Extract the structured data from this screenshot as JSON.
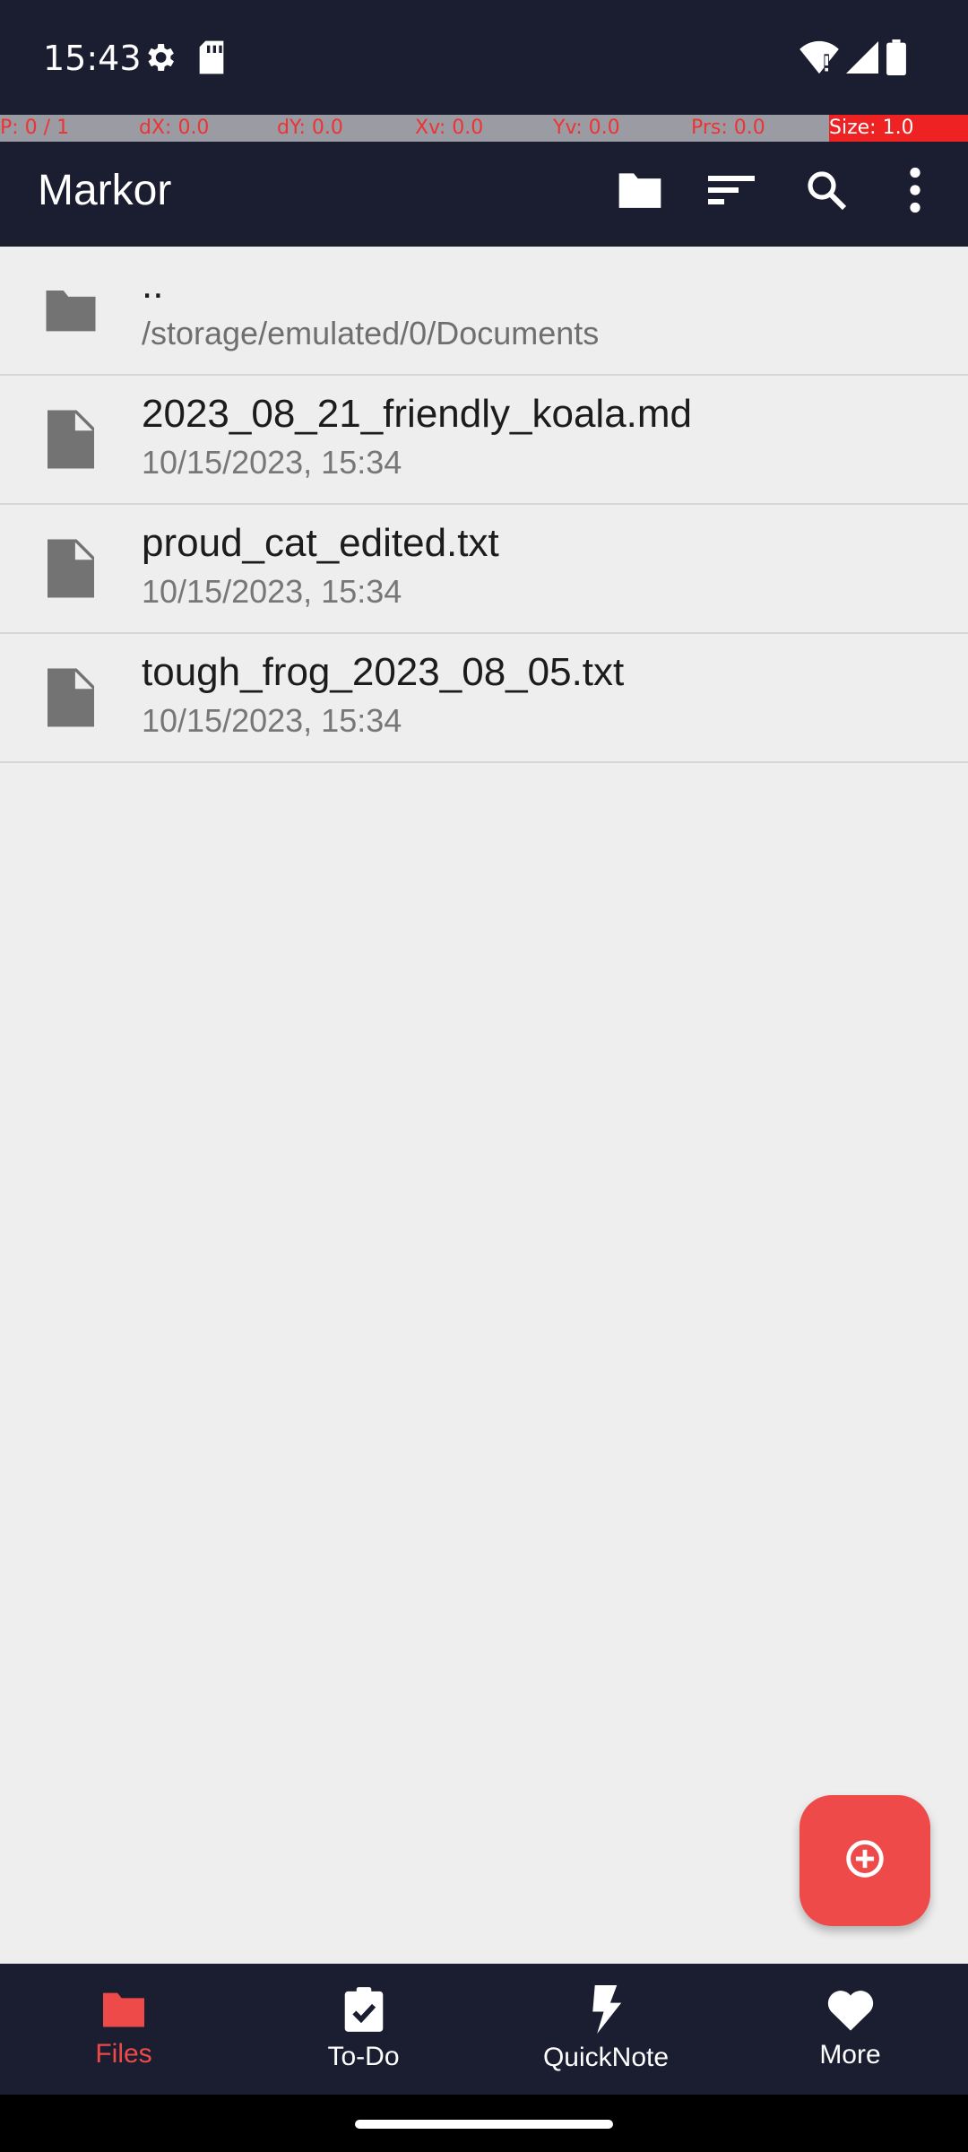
{
  "status_bar": {
    "time": "15:43",
    "icons": [
      "settings-icon",
      "sd-card-icon",
      "wifi-icon",
      "signal-icon",
      "battery-icon"
    ]
  },
  "debug_bar": {
    "p": "P: 0 / 1",
    "dx": "dX: 0.0",
    "dy": "dY: 0.0",
    "xv": "Xv: 0.0",
    "yv": "Yv: 0.0",
    "prs": "Prs: 0.0",
    "size": "Size: 1.0"
  },
  "app_bar": {
    "title": "Markor",
    "actions": [
      "folder-icon",
      "sort-icon",
      "search-icon",
      "more-vert-icon"
    ]
  },
  "file_list": {
    "parent": {
      "name": "..",
      "path": "/storage/emulated/0/Documents"
    },
    "files": [
      {
        "name": "2023_08_21_friendly_koala.md",
        "date": "10/15/2023, 15:34"
      },
      {
        "name": "proud_cat_edited.txt",
        "date": "10/15/2023, 15:34"
      },
      {
        "name": "tough_frog_2023_08_05.txt",
        "date": "10/15/2023, 15:34"
      }
    ]
  },
  "bottom_nav": {
    "items": [
      {
        "label": "Files",
        "icon": "folder-icon",
        "active": true
      },
      {
        "label": "To-Do",
        "icon": "checklist-icon",
        "active": false
      },
      {
        "label": "QuickNote",
        "icon": "bolt-icon",
        "active": false
      },
      {
        "label": "More",
        "icon": "heart-icon",
        "active": false
      }
    ]
  },
  "colors": {
    "bar_bg": "#1b1d31",
    "accent": "#ef4a4a",
    "list_bg": "#eeeeee"
  }
}
